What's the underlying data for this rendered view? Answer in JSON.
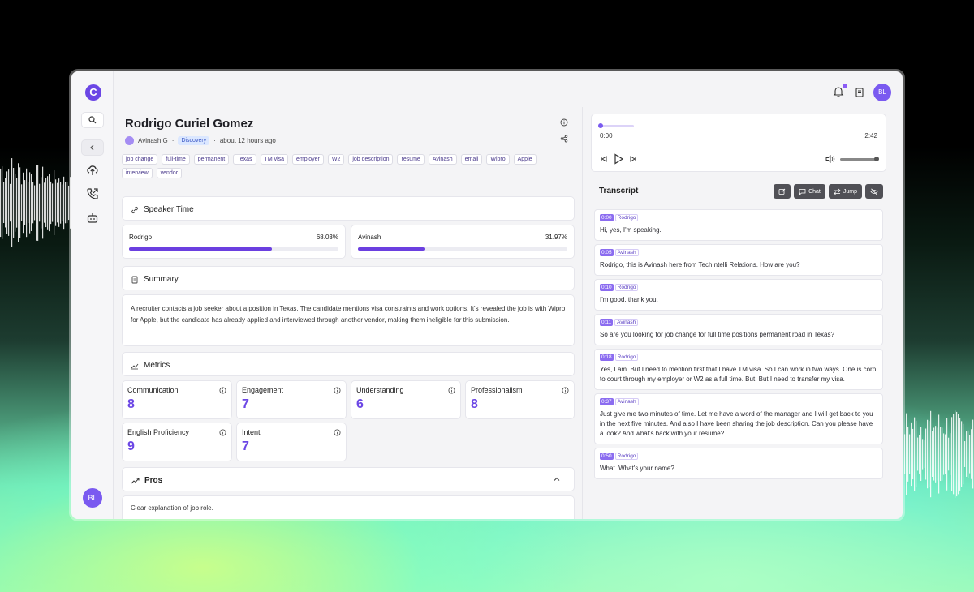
{
  "app": {
    "logo_letter": "C",
    "user_initials": "BL"
  },
  "profile": {
    "name": "Rodrigo Curiel Gomez",
    "owner": "Avinash G",
    "stage": "Discovery",
    "time_ago": "about 12 hours ago"
  },
  "tags": [
    "job change",
    "full-time",
    "permanent",
    "Texas",
    "TM visa",
    "employer",
    "W2",
    "job description",
    "resume",
    "Avinash",
    "email",
    "Wipro",
    "Apple",
    "interview",
    "vendor"
  ],
  "speaker_time": {
    "title": "Speaker Time",
    "speakers": [
      {
        "name": "Rodrigo",
        "percent_label": "68.03%",
        "fraction": 0.6803
      },
      {
        "name": "Avinash",
        "percent_label": "31.97%",
        "fraction": 0.3197
      }
    ]
  },
  "summary": {
    "title": "Summary",
    "text": "A recruiter contacts a job seeker about a position in Texas. The candidate mentions visa constraints and work options. It's revealed the job is with Wipro for Apple, but the candidate has already applied and interviewed through another vendor, making them ineligible for this submission."
  },
  "metrics": {
    "title": "Metrics",
    "items": [
      {
        "label": "Communication",
        "value": "8"
      },
      {
        "label": "Engagement",
        "value": "7"
      },
      {
        "label": "Understanding",
        "value": "6"
      },
      {
        "label": "Professionalism",
        "value": "8"
      },
      {
        "label": "English Proficiency",
        "value": "9"
      },
      {
        "label": "Intent",
        "value": "7"
      }
    ]
  },
  "pros": {
    "title": "Pros",
    "items": [
      "Clear explanation of job role."
    ]
  },
  "player": {
    "current": "0:00",
    "duration": "2:42",
    "progress": 0.0,
    "volume": 1.0
  },
  "transcript": {
    "title": "Transcript",
    "buttons": {
      "chat": "Chat",
      "jump": "Jump"
    },
    "entries": [
      {
        "time": "0:00",
        "speaker": "Rodrigo",
        "text": "Hi, yes, I'm speaking."
      },
      {
        "time": "0:05",
        "speaker": "Avinash",
        "text": "Rodrigo, this is Avinash here from TechIntelli Relations. How are you?"
      },
      {
        "time": "0:10",
        "speaker": "Rodrigo",
        "text": "I'm good, thank you."
      },
      {
        "time": "0:11",
        "speaker": "Avinash",
        "text": "So are you looking for job change for full time positions permanent road in Texas?"
      },
      {
        "time": "0:18",
        "speaker": "Rodrigo",
        "text": "Yes, I am. But I need to mention first that I have TM visa. So I can work in two ways. One is corp to court through my employer or W2 as a full time. But. But I need to transfer my visa."
      },
      {
        "time": "0:37",
        "speaker": "Avinash",
        "text": "Just give me two minutes of time. Let me have a word of the manager and I will get back to you in the next five minutes. And also I have been sharing the job description. Can you please have a look? And what's back with your resume?"
      },
      {
        "time": "0:50",
        "speaker": "Rodrigo",
        "text": "What. What's your name?"
      }
    ]
  },
  "colors": {
    "accent": "#6b46e5",
    "bar": "#6b3fe0",
    "badge_bg": "#dbe7ff"
  }
}
